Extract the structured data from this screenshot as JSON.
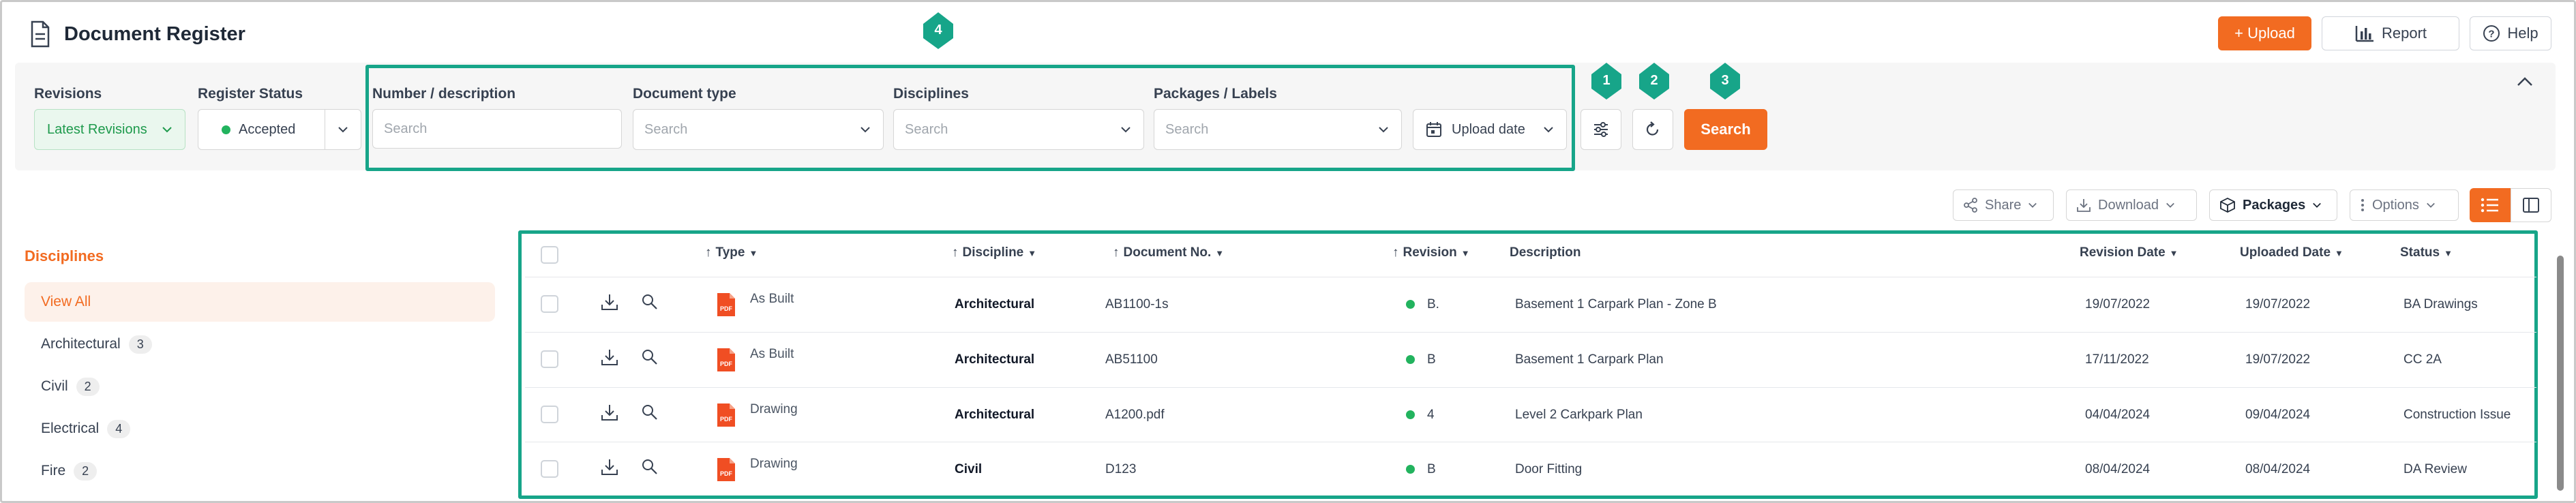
{
  "header": {
    "title": "Document Register",
    "upload_label": "+ Upload",
    "report_label": "Report",
    "help_label": "Help"
  },
  "filters": {
    "revisions": {
      "label": "Revisions",
      "value": "Latest Revisions"
    },
    "register_status": {
      "label": "Register Status",
      "value": "Accepted"
    },
    "number_description": {
      "label": "Number / description",
      "placeholder": "Search"
    },
    "document_type": {
      "label": "Document type",
      "placeholder": "Search"
    },
    "disciplines": {
      "label": "Disciplines",
      "placeholder": "Search"
    },
    "packages_labels": {
      "label": "Packages / Labels",
      "placeholder": "Search"
    },
    "date_select": {
      "value": "Upload date"
    },
    "search_label": "Search"
  },
  "annotations": {
    "m1": "1",
    "m2": "2",
    "m3": "3",
    "m4": "4"
  },
  "toolbar": {
    "share": "Share",
    "download": "Download",
    "packages": "Packages",
    "options": "Options"
  },
  "sidebar": {
    "title": "Disciplines",
    "items": [
      {
        "label": "View All",
        "count": ""
      },
      {
        "label": "Architectural",
        "count": "3"
      },
      {
        "label": "Civil",
        "count": "2"
      },
      {
        "label": "Electrical",
        "count": "4"
      },
      {
        "label": "Fire",
        "count": "2"
      }
    ]
  },
  "table": {
    "columns": [
      "Type",
      "Discipline",
      "Document No.",
      "Revision",
      "Description",
      "Revision Date",
      "Uploaded Date",
      "Status"
    ],
    "rows": [
      {
        "type": "As Built",
        "discipline": "Architectural",
        "doc_no": "AB1100-1s",
        "revision": "B.",
        "description": "Basement 1 Carpark Plan - Zone B",
        "revision_date": "19/07/2022",
        "uploaded_date": "19/07/2022",
        "status": "BA Drawings"
      },
      {
        "type": "As Built",
        "discipline": "Architectural",
        "doc_no": "AB51100",
        "revision": "B",
        "description": "Basement 1 Carpark Plan",
        "revision_date": "17/11/2022",
        "uploaded_date": "19/07/2022",
        "status": "CC 2A"
      },
      {
        "type": "Drawing",
        "discipline": "Architectural",
        "doc_no": "A1200.pdf",
        "revision": "4",
        "description": "Level 2 Carkpark Plan",
        "revision_date": "04/04/2024",
        "uploaded_date": "09/04/2024",
        "status": "Construction Issue"
      },
      {
        "type": "Drawing",
        "discipline": "Civil",
        "doc_no": "D123",
        "revision": "B",
        "description": "Door Fitting",
        "revision_date": "08/04/2024",
        "uploaded_date": "08/04/2024",
        "status": "DA Review"
      }
    ],
    "pdf_badge": "PDF"
  },
  "colors": {
    "accent": "#f26b21",
    "highlight": "#17a589",
    "status_dot": "#22b35e"
  }
}
